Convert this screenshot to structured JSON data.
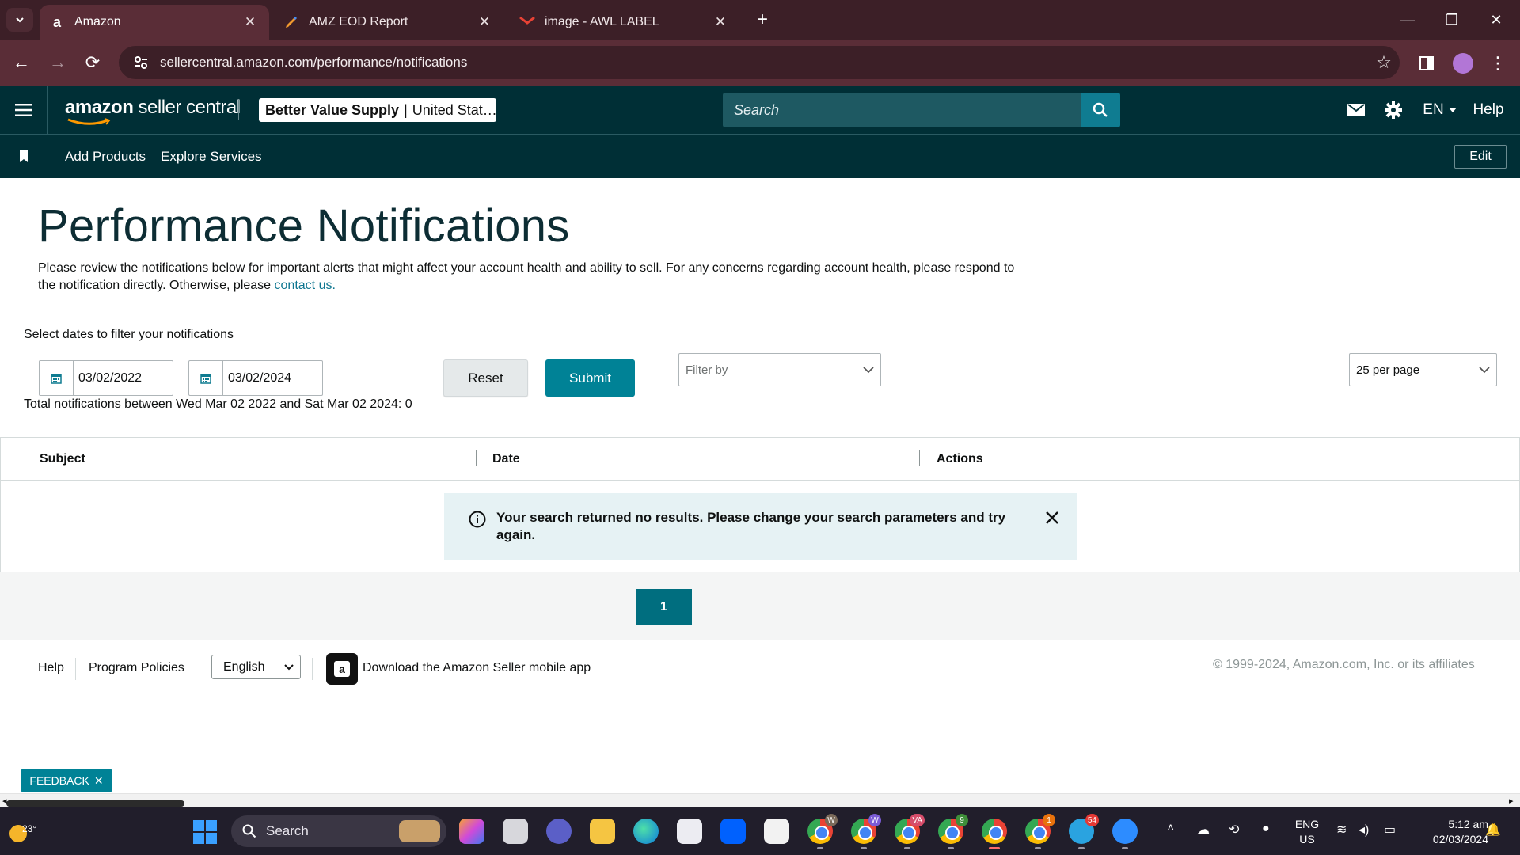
{
  "browser": {
    "tabs": [
      {
        "label": "Amazon",
        "favicon": "amazon-a"
      },
      {
        "label": "AMZ EOD Report",
        "favicon": "pen-icon"
      },
      {
        "label": "image - AWL LABEL",
        "favicon": "gmail-icon"
      }
    ],
    "url": "sellercentral.amazon.com/performance/notifications"
  },
  "header": {
    "logo_brand": "amazon",
    "logo_suffix": "seller central",
    "store_name": "Better Value Supply",
    "store_region": "United Stat…",
    "search_placeholder": "Search",
    "language": "EN",
    "help": "Help"
  },
  "nav": {
    "items": [
      "Add Products",
      "Explore Services"
    ],
    "edit": "Edit"
  },
  "main": {
    "title": "Performance Notifications",
    "description": "Please review the notifications below for important alerts that might affect your account health and ability to sell. For any concerns regarding account health, please respond to the notification directly. Otherwise, please",
    "contact_link": "contact us.",
    "filter_label": "Select dates to filter your notifications",
    "date_from": "03/02/2022",
    "date_to": "03/02/2024",
    "reset": "Reset",
    "submit": "Submit",
    "filter_placeholder": "Filter by",
    "per_page": "25 per page",
    "total": "Total notifications between Wed Mar 02 2022 and Sat Mar 02 2024: 0"
  },
  "table": {
    "columns": [
      "Subject",
      "Date",
      "Actions"
    ],
    "alert": "Your search returned no results. Please change your search parameters and try again."
  },
  "pagination": {
    "current": "1"
  },
  "footer": {
    "help": "Help",
    "policies": "Program Policies",
    "language": "English",
    "app_link": "Download the Amazon Seller mobile app",
    "copyright": "© 1999-2024, Amazon.com, Inc. or its affiliates"
  },
  "feedback": "FEEDBACK",
  "taskbar": {
    "temperature": "23°",
    "search": "Search",
    "badges": [
      "W",
      "W",
      "VA",
      "9",
      "1",
      "54"
    ],
    "lang_top": "ENG",
    "lang_bottom": "US",
    "time": "5:12 am",
    "date": "02/03/2024"
  },
  "colors": {
    "header_bg": "#002f36",
    "accent": "#008296",
    "title": "#0d2d34",
    "link": "#0e7690",
    "alert_bg": "#e6f2f4",
    "browser_frame": "#5a2d37"
  }
}
